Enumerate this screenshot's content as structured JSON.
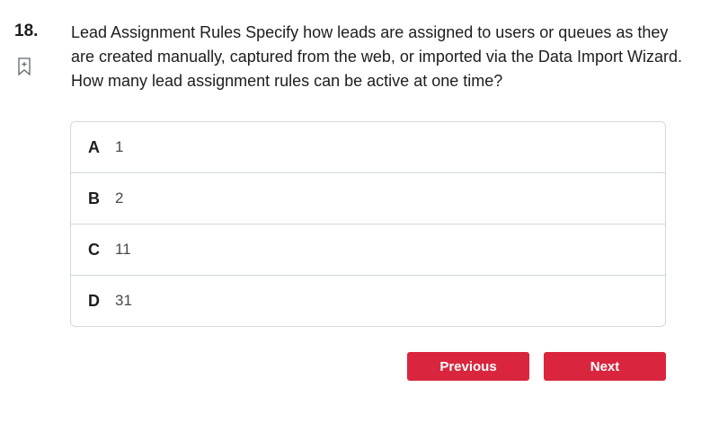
{
  "question": {
    "number": "18.",
    "text": "Lead Assignment Rules Specify how leads are assigned to users or queues as they are created manually, captured from the web, or imported via the Data Import Wizard. How many lead assignment rules can be active at one time?",
    "bookmark_icon": "bookmark-icon"
  },
  "options": [
    {
      "letter": "A",
      "text": "1"
    },
    {
      "letter": "B",
      "text": "2"
    },
    {
      "letter": "C",
      "text": "11"
    },
    {
      "letter": "D",
      "text": "31"
    }
  ],
  "navigation": {
    "previous_label": "Previous",
    "next_label": "Next"
  },
  "colors": {
    "button": "#d9263e",
    "border": "#d1d7dc",
    "text": "#1c1d1f"
  }
}
